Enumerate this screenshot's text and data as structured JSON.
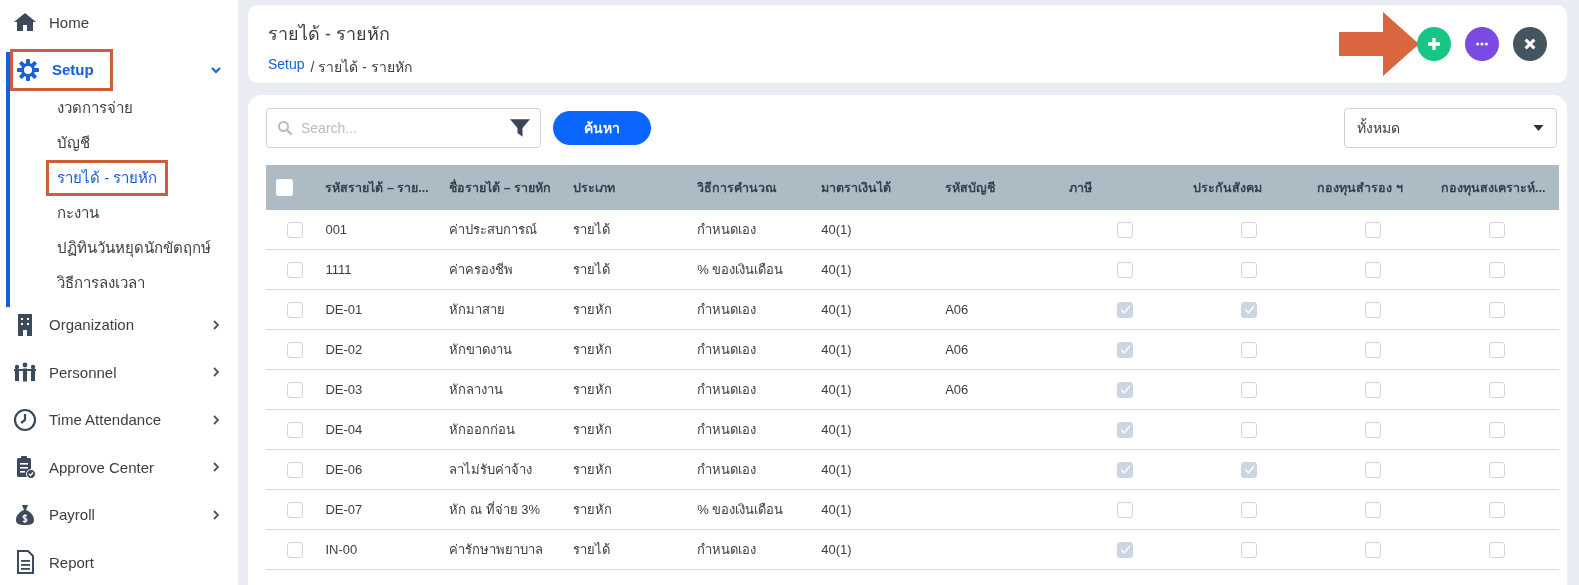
{
  "sidebar": {
    "items": [
      {
        "label": "Home",
        "kind": "link",
        "highlighted": false
      },
      {
        "label": "Setup",
        "kind": "group",
        "expanded": true,
        "highlighted": true,
        "children": [
          {
            "label": "งวดการจ่าย",
            "selected": false,
            "highlighted": false
          },
          {
            "label": "บัญชี",
            "selected": false,
            "highlighted": false
          },
          {
            "label": "รายได้ - รายหัก",
            "selected": true,
            "highlighted": true
          },
          {
            "label": "กะงาน",
            "selected": false,
            "highlighted": false
          },
          {
            "label": "ปฏิทินวันหยุดนักขัตฤกษ์",
            "selected": false,
            "highlighted": false
          },
          {
            "label": "วิธีการลงเวลา",
            "selected": false,
            "highlighted": false
          }
        ]
      },
      {
        "label": "Organization",
        "kind": "group",
        "expanded": false,
        "highlighted": false
      },
      {
        "label": "Personnel",
        "kind": "group",
        "expanded": false,
        "highlighted": false
      },
      {
        "label": "Time Attendance",
        "kind": "group",
        "expanded": false,
        "highlighted": false
      },
      {
        "label": "Approve Center",
        "kind": "group",
        "expanded": false,
        "highlighted": false
      },
      {
        "label": "Payroll",
        "kind": "group",
        "expanded": false,
        "highlighted": false
      },
      {
        "label": "Report",
        "kind": "link",
        "highlighted": false
      }
    ]
  },
  "header": {
    "title": "รายได้ - รายหัก",
    "breadcrumb": [
      {
        "label": "Setup",
        "kind": "link"
      },
      {
        "label": "/ รายได้ - รายหัก",
        "kind": "current"
      }
    ],
    "actions": [
      {
        "kind": "add",
        "pointed": true
      },
      {
        "kind": "more",
        "pointed": false
      },
      {
        "kind": "close",
        "pointed": false
      }
    ]
  },
  "toolbar": {
    "search": {
      "placeholder": "Search..."
    },
    "search_button": "ค้นหา",
    "filter": {
      "value": "ทั้งหมด"
    }
  },
  "table": {
    "header_checked": false,
    "columns": [
      {
        "label": "รหัสรายได้ – ราย...",
        "kind": "text"
      },
      {
        "label": "ชื่อรายได้ – รายหัก",
        "kind": "text"
      },
      {
        "label": "ประเภท",
        "kind": "text"
      },
      {
        "label": "วิธีการคำนวณ",
        "kind": "text"
      },
      {
        "label": "มาตราเงินได้",
        "kind": "text"
      },
      {
        "label": "รหัสบัญชี",
        "kind": "account"
      },
      {
        "label": "ภาษี",
        "kind": "check"
      },
      {
        "label": "ประกันสังคม",
        "kind": "check"
      },
      {
        "label": "กองทุนสำรอง ฯ",
        "kind": "check"
      },
      {
        "label": "กองทุนสงเคราะห์...",
        "kind": "check"
      }
    ],
    "rows": [
      {
        "selected": false,
        "texts": [
          "001",
          "ค่าประสบการณ์",
          "รายได้",
          "กำหนดเอง",
          "40(1)"
        ],
        "checks": [
          false,
          false,
          false,
          false
        ]
      },
      {
        "selected": false,
        "texts": [
          "1111",
          "ค่าครองชีพ",
          "รายได้",
          "% ของเงินเดือน",
          "40(1)"
        ],
        "checks": [
          false,
          false,
          false,
          false
        ]
      },
      {
        "selected": false,
        "texts": [
          "DE-01",
          "หักมาสาย",
          "รายหัก",
          "กำหนดเอง",
          "40(1)"
        ],
        "account": "A06",
        "checks": [
          true,
          true,
          false,
          false
        ]
      },
      {
        "selected": false,
        "texts": [
          "DE-02",
          "หักขาดงาน",
          "รายหัก",
          "กำหนดเอง",
          "40(1)"
        ],
        "account": "A06",
        "checks": [
          true,
          false,
          false,
          false
        ]
      },
      {
        "selected": false,
        "texts": [
          "DE-03",
          "หักลางาน",
          "รายหัก",
          "กำหนดเอง",
          "40(1)"
        ],
        "account": "A06",
        "checks": [
          true,
          false,
          false,
          false
        ]
      },
      {
        "selected": false,
        "texts": [
          "DE-04",
          "หักออกก่อน",
          "รายหัก",
          "กำหนดเอง",
          "40(1)"
        ],
        "checks": [
          true,
          false,
          false,
          false
        ]
      },
      {
        "selected": false,
        "texts": [
          "DE-06",
          "ลาไม่รับค่าจ้าง",
          "รายหัก",
          "กำหนดเอง",
          "40(1)"
        ],
        "checks": [
          true,
          true,
          false,
          false
        ]
      },
      {
        "selected": false,
        "texts": [
          "DE-07",
          "หัก ณ ที่จ่าย 3%",
          "รายหัก",
          "% ของเงินเดือน",
          "40(1)"
        ],
        "checks": [
          false,
          false,
          false,
          false
        ]
      },
      {
        "selected": false,
        "texts": [
          "IN-00",
          "ค่ารักษาพยาบาล",
          "รายได้",
          "กำหนดเอง",
          "40(1)"
        ],
        "checks": [
          true,
          false,
          false,
          false
        ]
      }
    ]
  }
}
